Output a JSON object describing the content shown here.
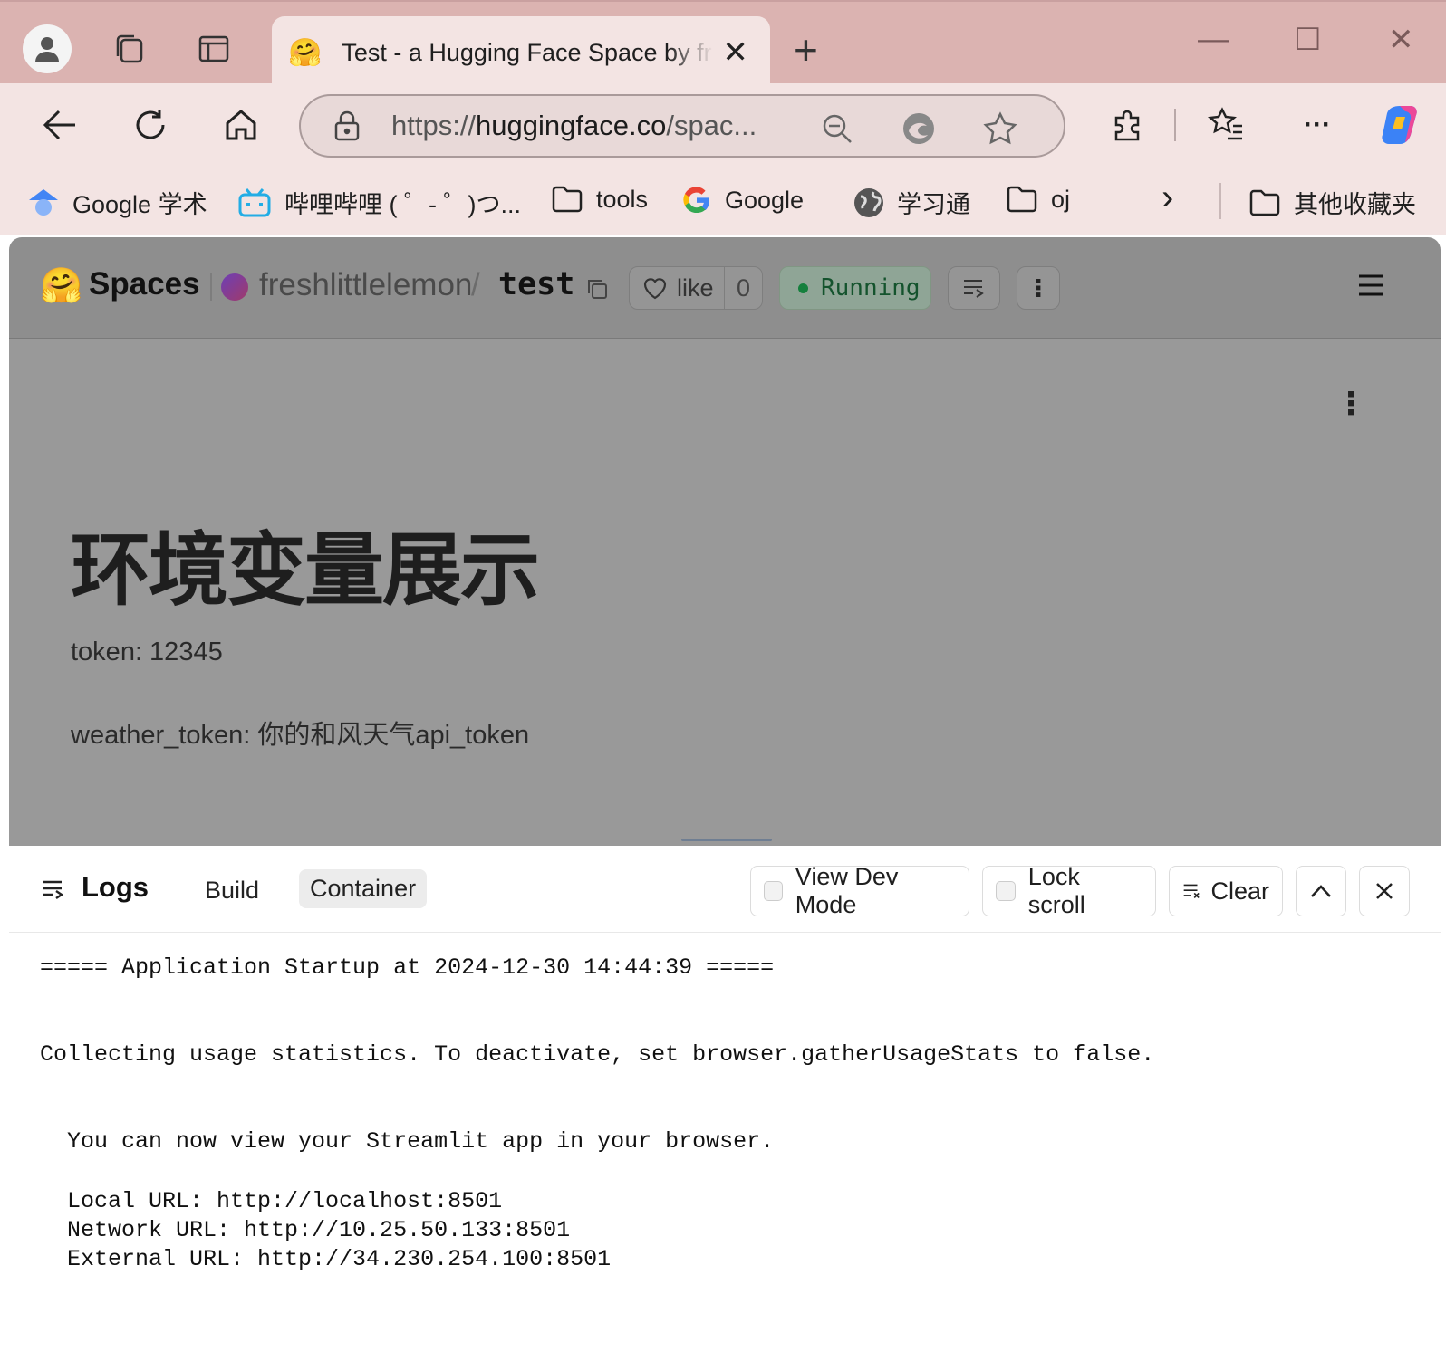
{
  "browser": {
    "tab_title": "Test - a Hugging Face Space by freshlittlelemon",
    "tab_icon": "🤗",
    "url_prefix": "https://",
    "url_host": "huggingface.co",
    "url_rest": "/spac...",
    "new_tab_symbol": "+",
    "window_controls": {
      "minimize": "—",
      "maximize": "☐",
      "close": "✕"
    },
    "more_symbol": "···",
    "chevron_symbol": "›"
  },
  "bookmarks": [
    {
      "label": "Google 学术",
      "icon": "google-scholar-icon"
    },
    {
      "label": "哔哩哔哩 ( ゜- ゜)つ...",
      "icon": "bilibili-icon"
    },
    {
      "label": "tools",
      "icon": "folder-icon"
    },
    {
      "label": "Google",
      "icon": "google-icon"
    },
    {
      "label": "学习通",
      "icon": "globe-icon"
    },
    {
      "label": "oj",
      "icon": "folder-icon"
    }
  ],
  "bookmarks_other": "其他收藏夹",
  "space": {
    "logo_emoji": "🤗",
    "spaces_label": "Spaces",
    "owner": "freshlittlelemon",
    "separator": "/",
    "name": "test",
    "like_label": "like",
    "like_count": "0",
    "status": "Running",
    "status_color": "#16a34a"
  },
  "app": {
    "title": "环境变量展示",
    "token_line": "token: 12345",
    "weather_line": "weather_token: 你的和风天气api_token"
  },
  "logs": {
    "title": "Logs",
    "tabs": [
      "Build",
      "Container"
    ],
    "active_tab": "Container",
    "view_dev_mode": "View Dev Mode",
    "lock_scroll": "Lock scroll",
    "clear": "Clear",
    "lines": [
      "===== Application Startup at 2024-12-30 14:44:39 =====",
      "Collecting usage statistics. To deactivate, set browser.gatherUsageStats to false.",
      "  You can now view your Streamlit app in your browser.",
      "  Local URL: http://localhost:8501",
      "  Network URL: http://10.25.50.133:8501",
      "  External URL: http://34.230.254.100:8501"
    ]
  }
}
